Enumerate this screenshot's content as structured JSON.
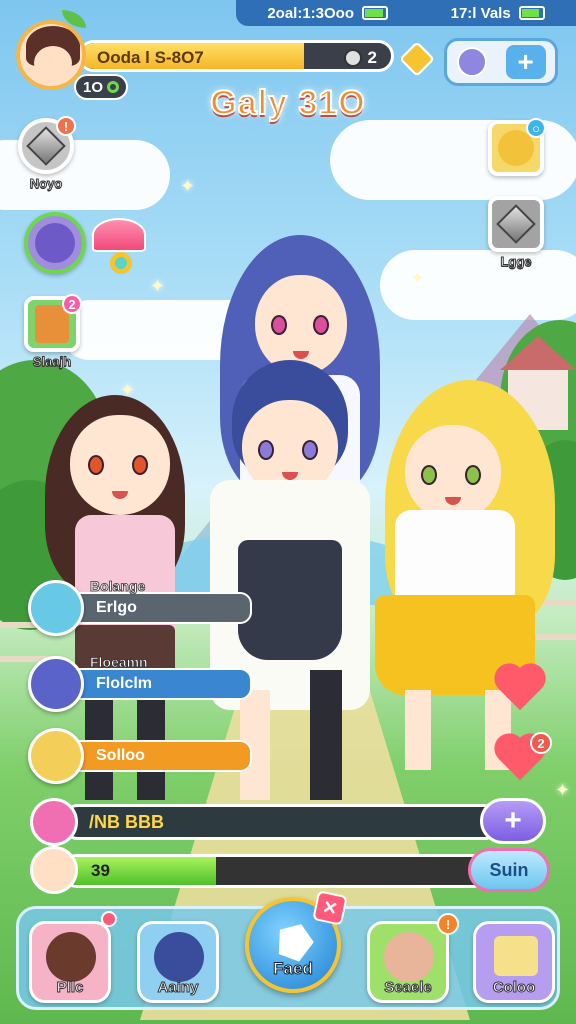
{
  "status_bar": {
    "left_text": "2oal:1:3Ooo",
    "right_text": "17:l Vals"
  },
  "profile": {
    "name": "Ooda l S-8O7",
    "currency": "2",
    "level": "1O"
  },
  "title": "Galy 31O",
  "left_icons": [
    {
      "label": "Noyo",
      "badge": ""
    },
    {
      "label": "",
      "badge": ""
    },
    {
      "label": "Slaajh",
      "badge": "2"
    }
  ],
  "right_icons": [
    {
      "label": ""
    },
    {
      "label": "Lgge"
    }
  ],
  "party": [
    {
      "sub": "Bolange",
      "name": "Erlgo",
      "color": "#5b6570"
    },
    {
      "sub": "Floeamn",
      "name": "Flolclm",
      "color": "#3a86d0"
    },
    {
      "sub": "",
      "name": "Solloo",
      "color": "#f39a23"
    }
  ],
  "mission": {
    "text": "/NB BBB"
  },
  "xp": {
    "value": "39",
    "spin_label": "Suin",
    "fill_pct": 0.36
  },
  "nav": [
    {
      "label": "Pllc"
    },
    {
      "label": "Aainy"
    },
    {
      "label": "Faed"
    },
    {
      "label": "Seaele",
      "badge": "!"
    },
    {
      "label": "Coloo"
    }
  ],
  "colors": {
    "accent": "#f6c431",
    "title": "#f28a2e",
    "nav_bg": "#78c8eb"
  },
  "hearts_badge": "2"
}
